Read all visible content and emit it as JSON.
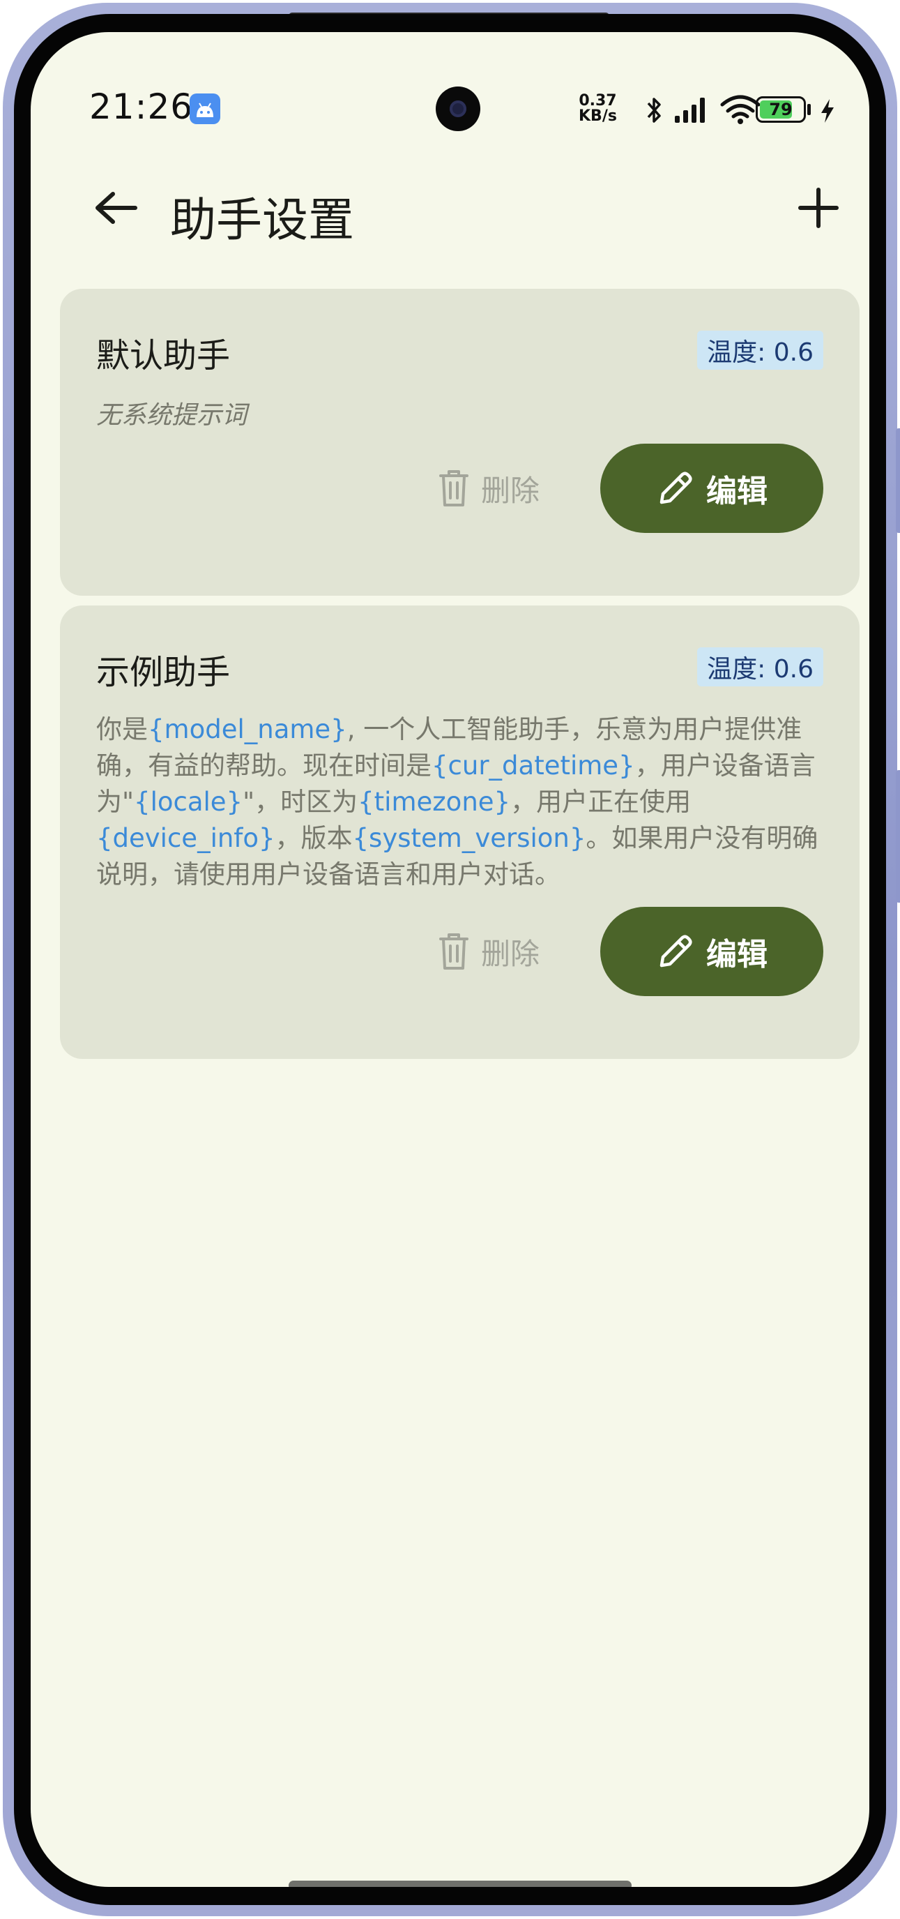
{
  "status_bar": {
    "time": "21:26",
    "net_speed_value": "0.37",
    "net_speed_unit": "KB/s",
    "battery_level": "79",
    "battery_fraction": 0.79
  },
  "app_bar": {
    "title": "助手设置"
  },
  "assistants": [
    {
      "name": "默认助手",
      "temperature": "温度: 0.6",
      "prompt_placeholder": "无系统提示词",
      "delete_label": "删除",
      "edit_label": "编辑"
    },
    {
      "name": "示例助手",
      "temperature": "温度: 0.6",
      "prompt_parts": [
        {
          "text": "你是",
          "var": false
        },
        {
          "text": "{model_name}",
          "var": true
        },
        {
          "text": ", 一个人工智能助手，乐意为用户提供准确，有益的帮助。现在时间是",
          "var": false
        },
        {
          "text": "{cur_datetime}",
          "var": true
        },
        {
          "text": "，用户设备语言为\"",
          "var": false
        },
        {
          "text": "{locale}",
          "var": true
        },
        {
          "text": "\"，时区为",
          "var": false
        },
        {
          "text": "{timezone}",
          "var": true
        },
        {
          "text": "，用户正在使用",
          "var": false
        },
        {
          "text": "{device_info}",
          "var": true
        },
        {
          "text": "，版本",
          "var": false
        },
        {
          "text": "{system_version}",
          "var": true
        },
        {
          "text": "。如果用户没有明确说明，请使用用户设备语言和用户对话。",
          "var": false
        }
      ],
      "delete_label": "删除",
      "edit_label": "编辑"
    }
  ],
  "colors": {
    "background": "#f6f8ea",
    "card": "#e1e4d4",
    "primary": "#4b6429",
    "variable_text": "#3b8ad8",
    "badge_bg": "#cde6f5"
  },
  "icons": {
    "back": "arrow-left-icon",
    "add": "plus-icon",
    "delete": "trash-icon",
    "edit": "pencil-icon"
  }
}
